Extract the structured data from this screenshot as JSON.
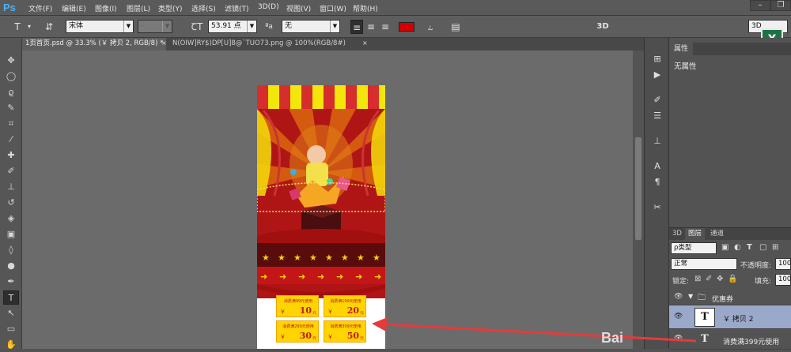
{
  "app": {
    "logo": "Ps"
  },
  "menu": [
    "文件(F)",
    "编辑(E)",
    "图像(I)",
    "图层(L)",
    "类型(Y)",
    "选择(S)",
    "滤镜(T)",
    "3D(D)",
    "视图(V)",
    "窗口(W)",
    "帮助(H)"
  ],
  "options": {
    "font_family": "宋体",
    "font_style": "-",
    "font_size": "53.91 点",
    "aa_label": "ªa",
    "antialias": "无",
    "mode_3d": "3D",
    "color": "#d40000"
  },
  "workspace": {
    "value": "3D"
  },
  "tabs": [
    "1页首页.psd @ 33.3% (￥ 拷贝 2, RGB/8) *",
    "N(OIW]RY$)DP[U]8@`TUO73.png @ 100%(RGB/8#)"
  ],
  "properties": {
    "tab": "属性",
    "empty": "无属性"
  },
  "layers": {
    "tabs": [
      "3D",
      "图层",
      "通道"
    ],
    "filter": "ρ类型",
    "blend_mode": "正常",
    "opacity_label": "不透明度:",
    "opacity": "100%",
    "lock_label": "锁定:",
    "fill_label": "填充:",
    "fill": "100%",
    "items": [
      {
        "name": "优惠券",
        "kind": "group"
      },
      {
        "name": "￥ 拷贝 2",
        "kind": "text",
        "selected": true
      },
      {
        "name": "消费满399元使用",
        "kind": "text"
      }
    ]
  },
  "coupons": [
    {
      "label": "消费满99元使用",
      "amount": "10"
    },
    {
      "label": "消费满199元使用",
      "amount": "20"
    },
    {
      "label": "消费满299元使用",
      "amount": "30"
    },
    {
      "label": "消费满399元使用",
      "amount": "50"
    }
  ],
  "coupon_symbols": {
    "yen": "￥",
    "unit": "元"
  },
  "excel_icon": "X",
  "watermark": "Bai"
}
